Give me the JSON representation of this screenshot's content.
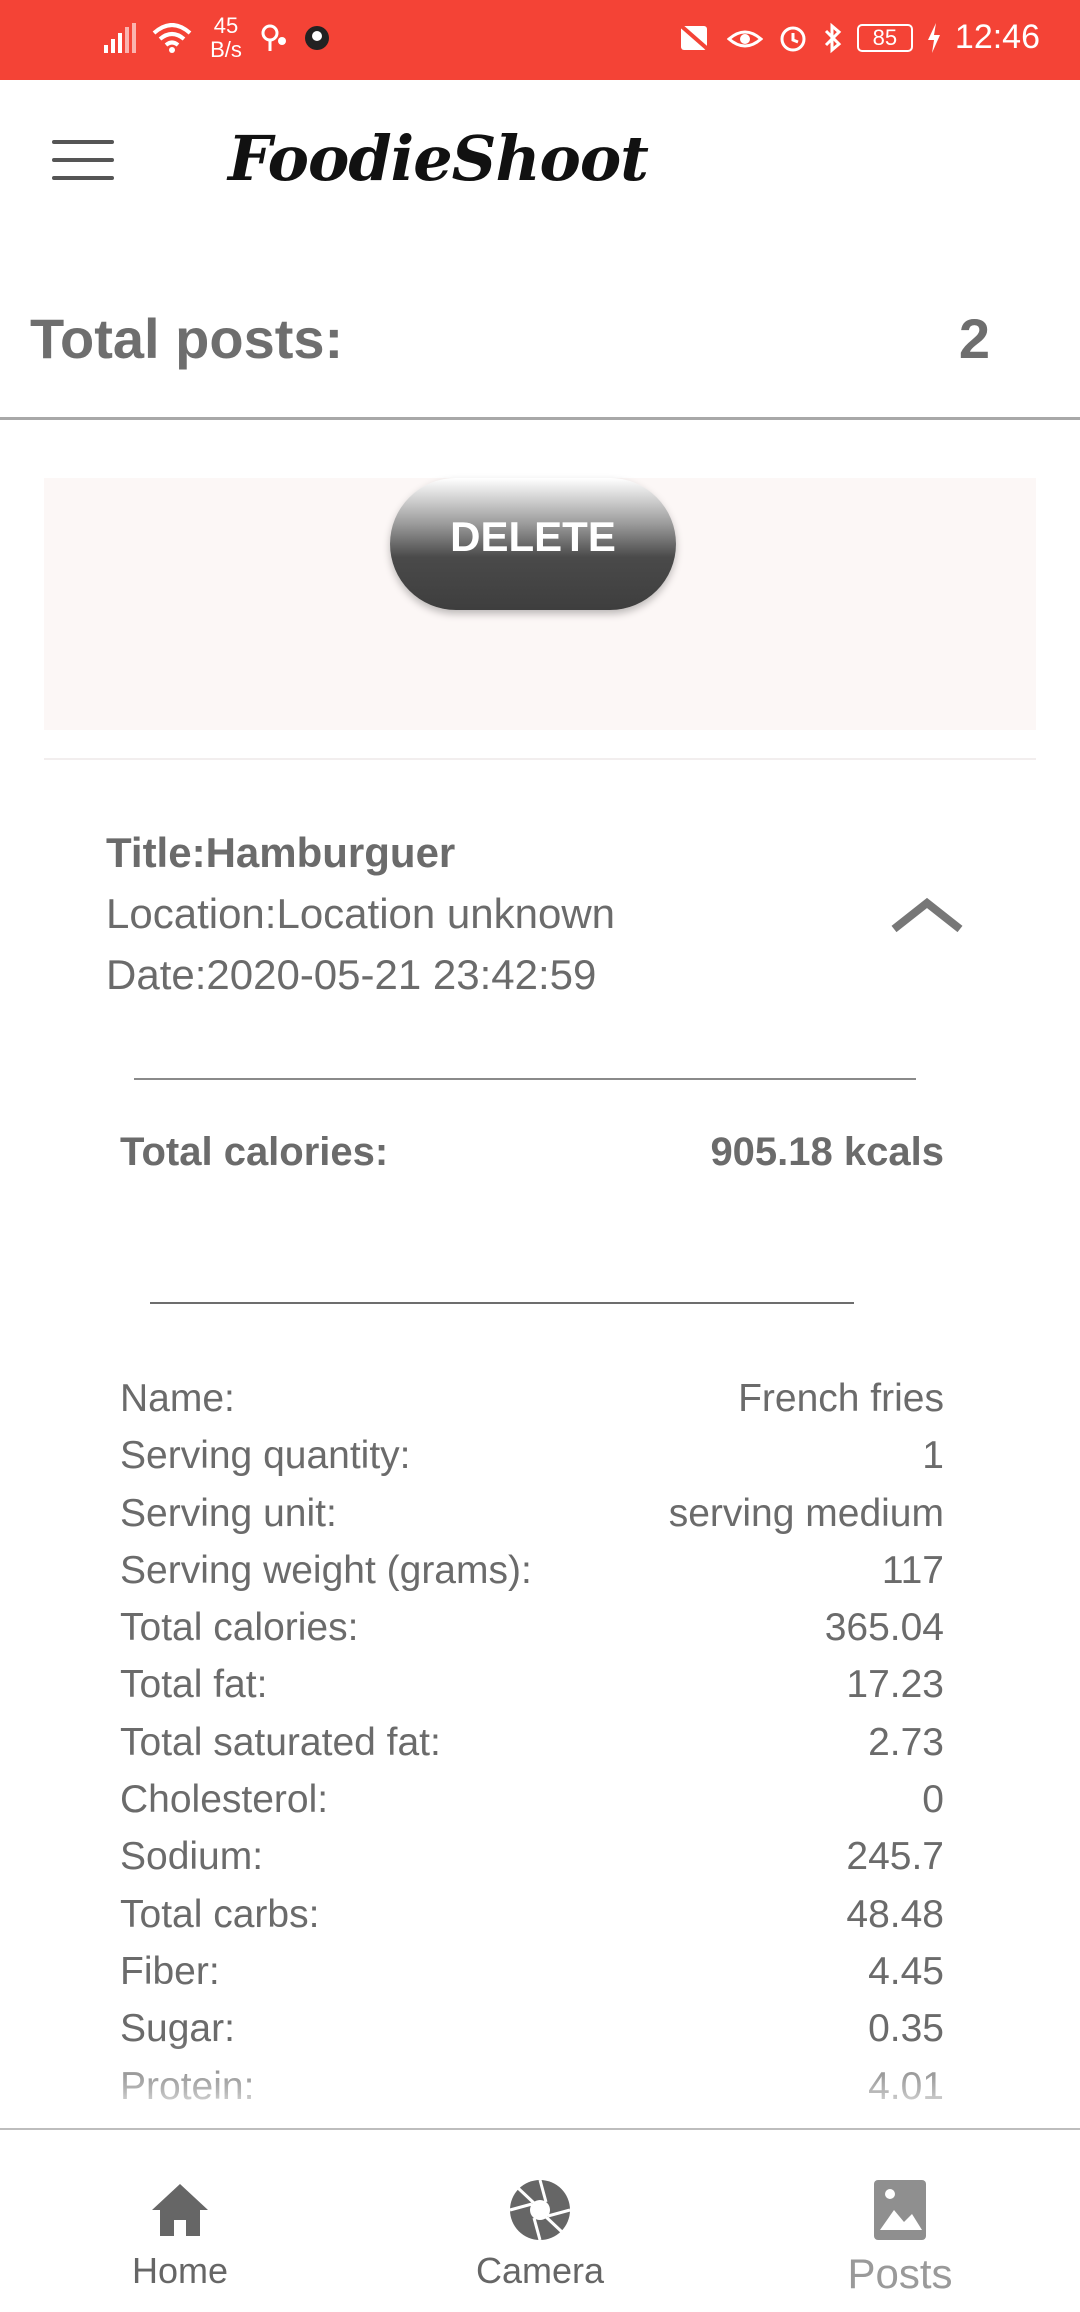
{
  "status_bar": {
    "net_speed": "45",
    "net_speed_unit": "B/s",
    "battery": "85",
    "time": "12:46"
  },
  "header": {
    "brand": "FoodieShoot",
    "menu_icon": "hamburger-menu-icon"
  },
  "summary": {
    "total_posts_label": "Total posts:",
    "total_posts_value": "2"
  },
  "actions": {
    "delete_label": "DELETE"
  },
  "post": {
    "title": "Title:Hamburguer",
    "location": "Location:Location unknown",
    "date": "Date:2020-05-21 23:42:59",
    "expanded": true,
    "total_calories_label": "Total calories:",
    "total_calories_value": "905.18 kcals"
  },
  "food_item": {
    "rows": [
      {
        "label": "Name:",
        "value": "French fries"
      },
      {
        "label": "Serving quantity:",
        "value": "1"
      },
      {
        "label": "Serving unit:",
        "value": "serving medium"
      },
      {
        "label": "Serving weight (grams):",
        "value": "117"
      },
      {
        "label": "Total calories:",
        "value": "365.04"
      },
      {
        "label": "Total fat:",
        "value": "17.23"
      },
      {
        "label": "Total saturated fat:",
        "value": "2.73"
      },
      {
        "label": "Cholesterol:",
        "value": "0"
      },
      {
        "label": "Sodium:",
        "value": "245.7"
      },
      {
        "label": "Total carbs:",
        "value": "48.48"
      },
      {
        "label": "Fiber:",
        "value": "4.45"
      },
      {
        "label": "Sugar:",
        "value": "0.35"
      },
      {
        "label": "Protein:",
        "value": "4.01"
      }
    ]
  },
  "bottom_nav": {
    "items": [
      {
        "label": "Home",
        "icon": "home-icon"
      },
      {
        "label": "Camera",
        "icon": "camera-shutter-icon"
      },
      {
        "label": "Posts",
        "icon": "image-gallery-icon",
        "active": true
      }
    ]
  },
  "colors": {
    "status_bar": "#f44336",
    "text_gray": "#6b6b6b",
    "delete_button": "#3e3e3e"
  }
}
